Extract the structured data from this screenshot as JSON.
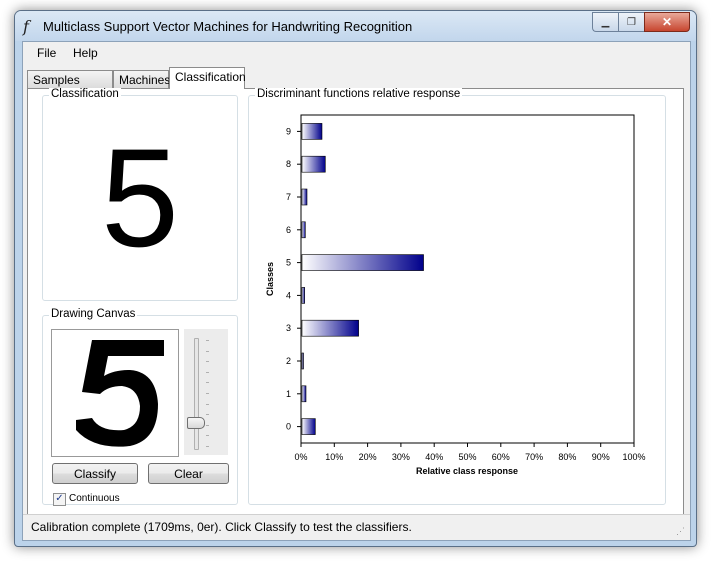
{
  "window": {
    "title": "Multiclass Support Vector Machines for Handwriting Recognition",
    "icon": "function-f-icon",
    "controls": {
      "minimize": "minimize-icon",
      "maximize": "maximize-icon",
      "close": "close-icon"
    }
  },
  "menu": [
    {
      "label": "File"
    },
    {
      "label": "Help"
    }
  ],
  "tabs": [
    {
      "label": "Samples (Input)",
      "active": false
    },
    {
      "label": "Machines",
      "active": false
    },
    {
      "label": "Classification",
      "active": true
    }
  ],
  "classification_group": {
    "label": "Classification",
    "result": "5"
  },
  "drawing_group": {
    "label": "Drawing Canvas",
    "drawn_digit": "5",
    "pen_slider": {
      "position_fraction": 0.75
    },
    "classify_button": "Classify",
    "clear_button": "Clear",
    "continuous_label": "Continuous",
    "continuous_checked": true,
    "check_mark": "✓"
  },
  "chart_group": {
    "label": "Discriminant functions relative response"
  },
  "chart_data": {
    "type": "bar",
    "orientation": "horizontal",
    "title": "",
    "xlabel": "Relative class response",
    "ylabel": "Classes",
    "categories": [
      "0",
      "1",
      "2",
      "3",
      "4",
      "5",
      "6",
      "7",
      "8",
      "9"
    ],
    "values": [
      4,
      1.2,
      0.3,
      17,
      0.8,
      36.5,
      1,
      1.5,
      7,
      6
    ],
    "xlim": [
      0,
      100
    ],
    "xticks": [
      "0%",
      "10%",
      "20%",
      "30%",
      "40%",
      "50%",
      "60%",
      "70%",
      "80%",
      "90%",
      "100%"
    ],
    "grid": false,
    "legend": "none",
    "bar_gradient": {
      "start": "#ffffff",
      "end": "#00008b"
    }
  },
  "status": {
    "text": "Calibration complete (1709ms, 0er). Click Classify to test the classifiers."
  }
}
